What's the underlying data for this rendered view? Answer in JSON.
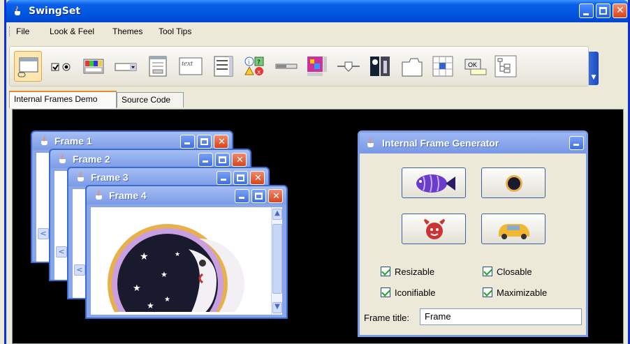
{
  "window": {
    "title": "SwingSet"
  },
  "menu": [
    "File",
    "Look & Feel",
    "Themes",
    "Tool Tips"
  ],
  "toolbar": {
    "tools": [
      "internal-frames",
      "buttons",
      "color-chooser",
      "combo-box",
      "file-chooser",
      "editor-pane",
      "list",
      "option-pane",
      "progress-bar",
      "scroll-pane",
      "slider",
      "split-pane",
      "tabbed-pane",
      "table",
      "tooltip",
      "tree"
    ],
    "text_tool_label": "text",
    "ok_label": "OK"
  },
  "tabs": [
    "Internal Frames Demo",
    "Source Code"
  ],
  "frames": [
    {
      "title": "Frame 1"
    },
    {
      "title": "Frame 2"
    },
    {
      "title": "Frame 3"
    },
    {
      "title": "Frame 4"
    }
  ],
  "generator": {
    "title": "Internal Frame Generator",
    "options": [
      {
        "label": "Resizable",
        "checked": true
      },
      {
        "label": "Closable",
        "checked": true
      },
      {
        "label": "Iconifiable",
        "checked": true
      },
      {
        "label": "Maximizable",
        "checked": true
      }
    ],
    "frame_title_label": "Frame title:",
    "frame_title_value": "Frame"
  }
}
